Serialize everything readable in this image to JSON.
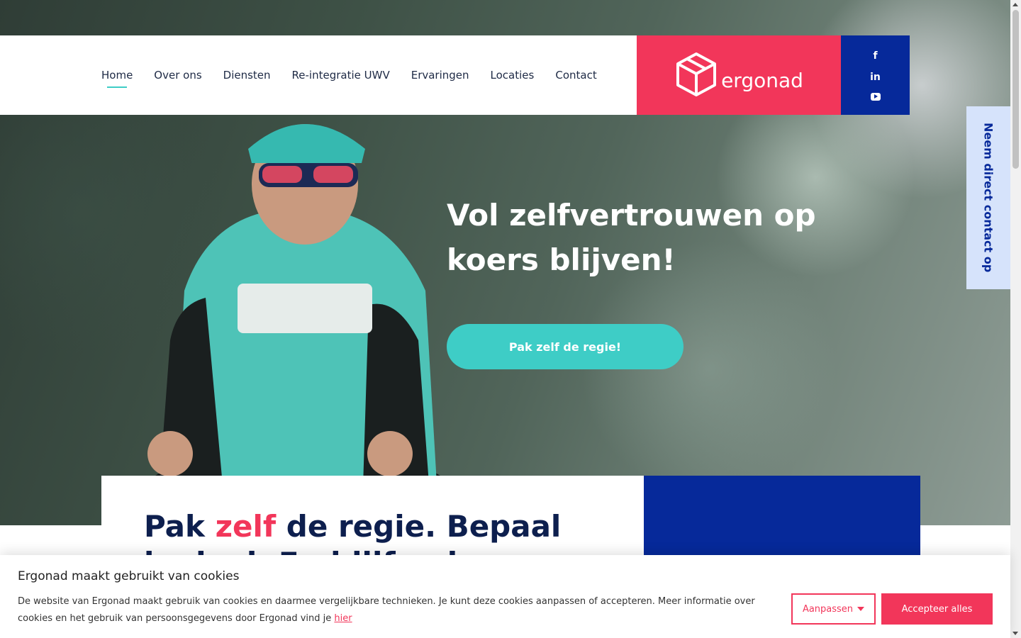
{
  "brand": {
    "logo_text": "ergonad",
    "pink": "#f2365a",
    "navy": "#06299a",
    "teal": "#3ecdc6"
  },
  "nav": {
    "items": [
      {
        "label": "Home",
        "active": true
      },
      {
        "label": "Over ons"
      },
      {
        "label": "Diensten"
      },
      {
        "label": "Re-integratie UWV"
      },
      {
        "label": "Ervaringen"
      },
      {
        "label": "Locaties"
      },
      {
        "label": "Contact"
      }
    ]
  },
  "social": {
    "facebook": "f",
    "linkedin": "in",
    "youtube_icon": "youtube-icon"
  },
  "hero": {
    "title": "Vol zelfvertrouwen op koers blijven!",
    "cta": "Pak zelf de regie!"
  },
  "side_tab": {
    "label": "Neem direct contact op"
  },
  "intro": {
    "title_before": "Pak ",
    "title_accent": "zelf",
    "title_after": " de regie. Bepaal je doel. Eu blijf gel"
  },
  "cookie": {
    "title": "Ergonad maakt gebruikt van cookies",
    "text": "De website van Ergonad maakt gebruik van cookies en daarmee vergelijkbare technieken. Je kunt deze cookies aanpassen of accepteren. Meer informatie over cookies en het gebruik van persoonsgegevens door Ergonad vind je ",
    "link": "hier",
    "customize": "Aanpassen",
    "accept": "Accepteer alles"
  }
}
